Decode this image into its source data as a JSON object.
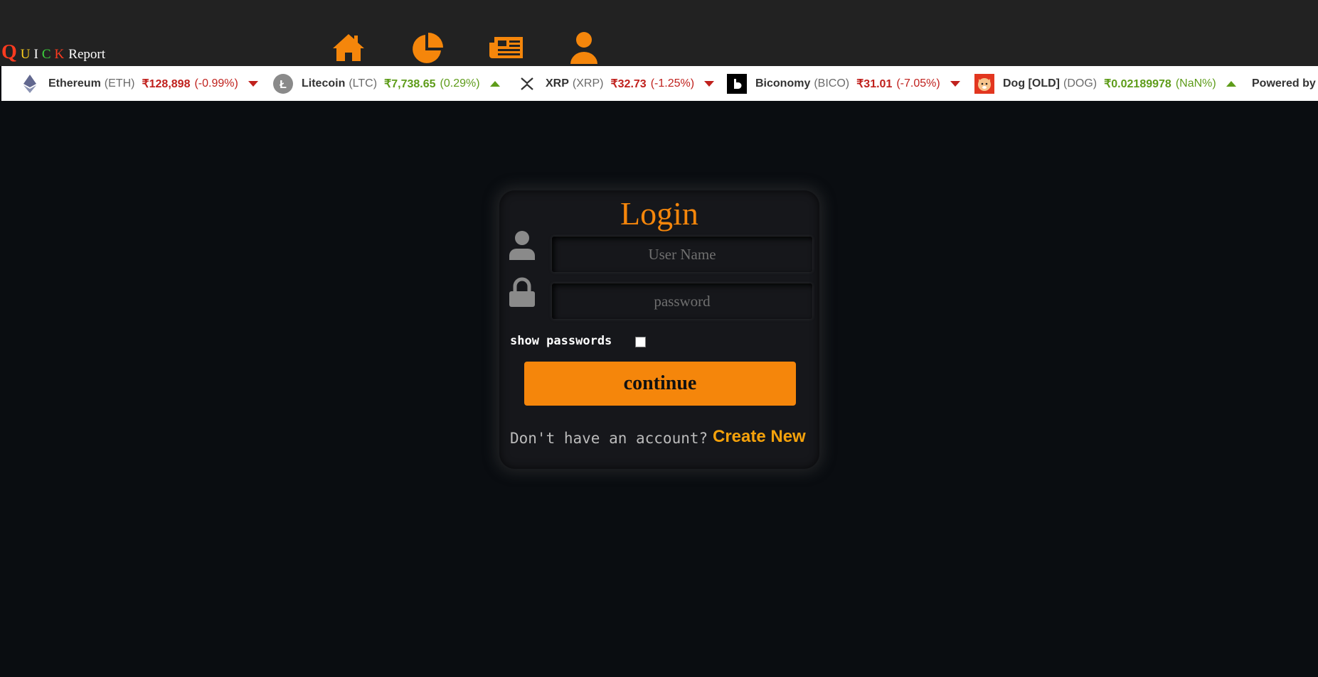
{
  "brand": {
    "letters": [
      {
        "char": "Q",
        "color": "#ff3b1f"
      },
      {
        "char": "U",
        "color": "#ffd21f"
      },
      {
        "char": "I",
        "color": "#ffffff"
      },
      {
        "char": "C",
        "color": "#3dd43d"
      },
      {
        "char": "K",
        "color": "#ff3b1f"
      }
    ],
    "suffix": "Report"
  },
  "nav": {
    "items": [
      "home-icon",
      "pie-chart-icon",
      "news-icon",
      "user-icon"
    ],
    "accent": "#f5860b"
  },
  "ticker": {
    "coins": [
      {
        "name": "Ethereum",
        "symbol": "(ETH)",
        "price": "₹128,898",
        "change": "(-0.99%)",
        "direction": "down",
        "icon": "ethereum-logo-icon"
      },
      {
        "name": "Litecoin",
        "symbol": "(LTC)",
        "price": "₹7,738.65",
        "change": "(0.29%)",
        "direction": "up",
        "icon": "litecoin-logo-icon"
      },
      {
        "name": "XRP",
        "symbol": "(XRP)",
        "price": "₹32.73",
        "change": "(-1.25%)",
        "direction": "down",
        "icon": "xrp-logo-icon"
      },
      {
        "name": "Biconomy",
        "symbol": "(BICO)",
        "price": "₹31.01",
        "change": "(-7.05%)",
        "direction": "down",
        "icon": "biconomy-logo-icon"
      },
      {
        "name": "Dog [OLD]",
        "symbol": "(DOG)",
        "price": "₹0.02189978",
        "change": "(NaN%)",
        "direction": "up",
        "icon": "dog-logo-icon"
      }
    ],
    "powered_by": "Powered by",
    "down_color": "#c0211d",
    "up_color": "#5e9c1a"
  },
  "login": {
    "title": "Login",
    "username_placeholder": "User Name",
    "password_placeholder": "password",
    "show_passwords_label": "show passwords",
    "continue_label": "continue",
    "no_account_text": "Don't have an account?",
    "create_new_label": "Create New"
  }
}
